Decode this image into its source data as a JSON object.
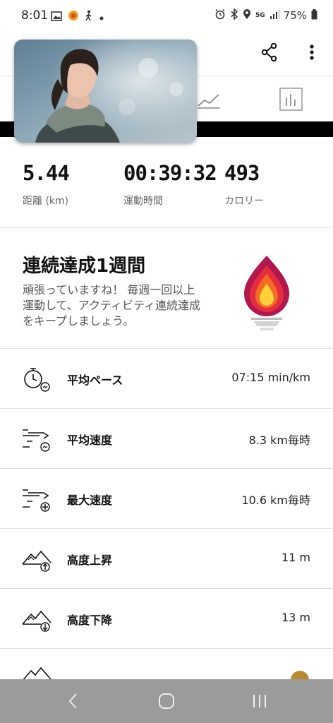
{
  "status_bar": {
    "time": "8:01",
    "battery": "75%",
    "network": "5G"
  },
  "toolbar": {
    "share_icon": "share-icon",
    "menu_icon": "more-vert-icon"
  },
  "tabs": [
    {
      "icon": "trend-chart-icon"
    },
    {
      "icon": "bar-chart-icon"
    }
  ],
  "summary": {
    "distance": {
      "value": "5.44",
      "label": "距離 (km)"
    },
    "duration": {
      "value": "00:39:32",
      "label": "運動時間"
    },
    "calories": {
      "value": "493",
      "label": "カロリー"
    }
  },
  "streak": {
    "title": "連続達成1週間",
    "description": "頑張っていますね！ 毎週一回以上運動して、アクティビティ連続達成をキープしましょう。",
    "icon": "flame-trophy-icon"
  },
  "metrics": [
    {
      "name": "平均ペース",
      "value": "07:15 min/km",
      "icon": "pace-clock-icon"
    },
    {
      "name": "平均速度",
      "value": "8.3 km毎時",
      "icon": "speed-avg-icon"
    },
    {
      "name": "最大速度",
      "value": "10.6 km毎時",
      "icon": "speed-max-icon"
    },
    {
      "name": "高度上昇",
      "value": "11 m",
      "icon": "elevation-up-icon"
    },
    {
      "name": "高度下降",
      "value": "13 m",
      "icon": "elevation-down-icon"
    }
  ],
  "colors": {
    "flame_outer": "#b3174f",
    "flame_mid": "#f0442a",
    "flame_inner": "#ffd23a",
    "navbar": "#9b9b9b"
  }
}
